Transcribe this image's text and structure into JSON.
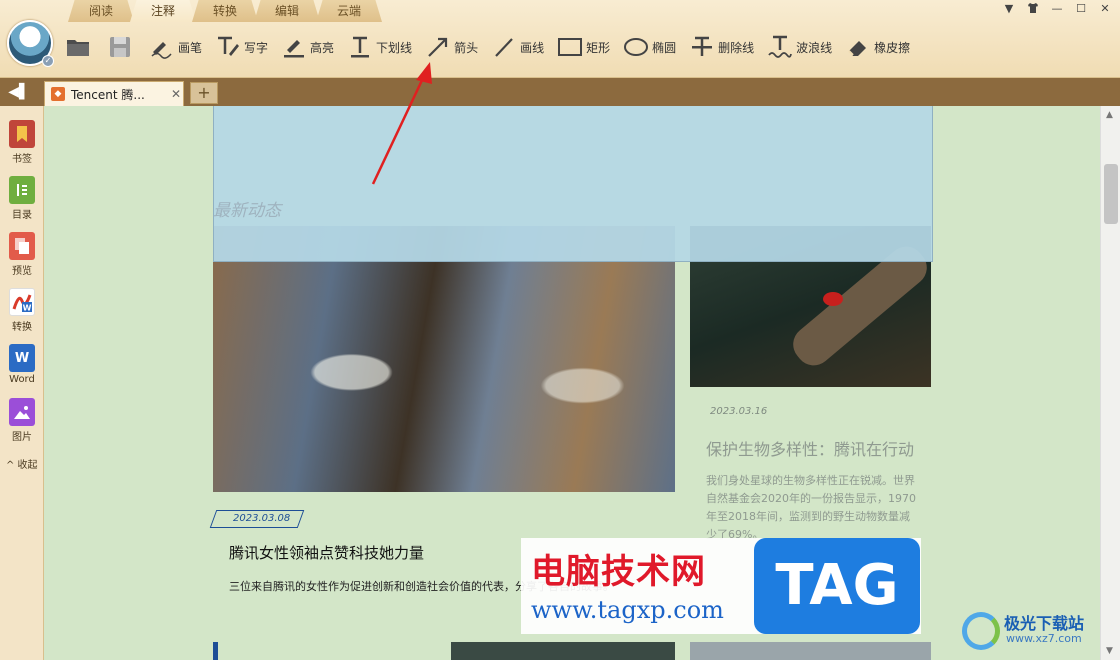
{
  "top_tabs": [
    "阅读",
    "注释",
    "转换",
    "编辑",
    "云端"
  ],
  "active_top_tab": "注释",
  "window_controls": [
    "▼",
    "👕",
    "—",
    "☐",
    "✕"
  ],
  "toolbar": {
    "tools": [
      {
        "id": "pen",
        "label": "画笔"
      },
      {
        "id": "write",
        "label": "写字"
      },
      {
        "id": "highlight",
        "label": "高亮"
      },
      {
        "id": "underline",
        "label": "下划线"
      },
      {
        "id": "arrow",
        "label": "箭头"
      },
      {
        "id": "line",
        "label": "画线"
      },
      {
        "id": "rect",
        "label": "矩形"
      },
      {
        "id": "ellipse",
        "label": "椭圆"
      },
      {
        "id": "strike",
        "label": "删除线"
      },
      {
        "id": "wave",
        "label": "波浪线"
      },
      {
        "id": "eraser",
        "label": "橡皮擦"
      }
    ]
  },
  "doc_tab": {
    "title": "Tencent 腾...",
    "close": "✕"
  },
  "add_tab": "+",
  "sidebar": {
    "items": [
      {
        "label": "书签",
        "color": "#c0453a"
      },
      {
        "label": "目录",
        "color": "#6fae3f"
      },
      {
        "label": "预览",
        "color": "#e25b4a"
      },
      {
        "label": "转换",
        "color": "#e04b3b"
      },
      {
        "label": "Word",
        "color": "#2b6bc4",
        "glyph": "W"
      },
      {
        "label": "图片",
        "color": "#9b4ed8"
      }
    ],
    "collapse": "^ 收起"
  },
  "content": {
    "section_title": "最新动态",
    "article_a": {
      "date": "2023.03.08",
      "heading": "腾讯女性领袖点赞科技她力量",
      "paragraph": "三位来自腾讯的女性作为促进创新和创造社会价值的代表，分享了各自的故事。"
    },
    "article_b": {
      "date": "2023.03.16",
      "heading": "保护生物多样性：腾讯在行动",
      "paragraph": "我们身处星球的生物多样性正在锐减。世界自然基金会2020年的一份报告显示，1970年至2018年间，监测到的野生动物数量减少了69%。"
    }
  },
  "watermark": {
    "cn": "电脑技术网",
    "url": "www.tagxp.com",
    "tag": "TAG"
  },
  "corner_logo": {
    "cn": "极光下载站",
    "url": "www.xz7.com"
  }
}
